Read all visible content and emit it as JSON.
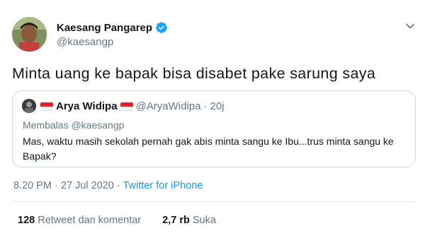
{
  "author": {
    "display_name": "Kaesang Pangarep",
    "handle": "@kaesangp",
    "verified": true
  },
  "tweet": {
    "text": "Minta uang ke bapak bisa disabet pake sarung saya"
  },
  "quoted_tweet": {
    "display_name": "Arya Widipa",
    "handle": "@AryaWidipa",
    "separator": "·",
    "time": "20j",
    "reply_to": "Membalas @kaesangp",
    "text": "Mas, waktu masih sekolah pernah gak abis minta sangu ke Ibu...trus minta sangu ke Bapak?"
  },
  "meta": {
    "timestamp": "8.20 PM · 27 Jul 2020",
    "separator": "·",
    "source": "Twitter for iPhone"
  },
  "stats": {
    "retweets_count": "128",
    "retweets_label": "Retweet dan komentar",
    "likes_count": "2,7 rb",
    "likes_label": "Suka"
  },
  "colors": {
    "link": "#1b95e0",
    "verified": "#1da1f2",
    "secondary_text": "#657786",
    "border": "#ccd6dd"
  },
  "icons": {
    "verified": "verified-badge-icon",
    "menu": "chevron-down-icon",
    "flag": "indonesia-flag-icon"
  }
}
